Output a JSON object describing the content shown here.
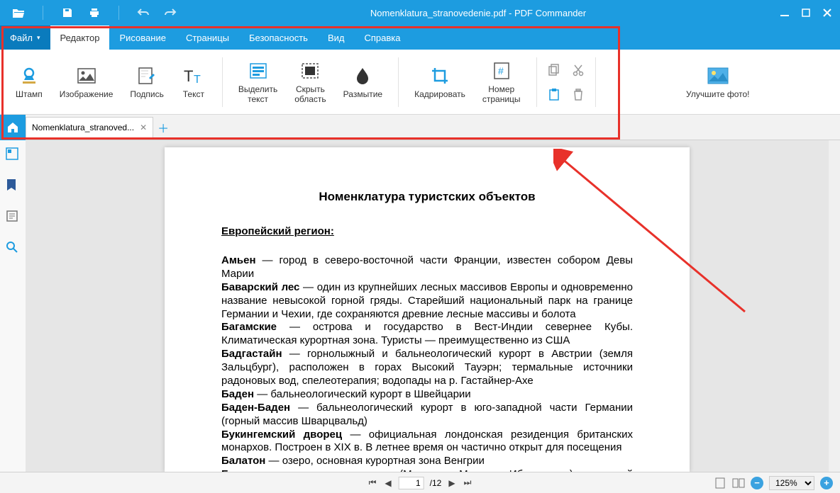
{
  "titlebar": {
    "title": "Nomenklatura_stranovedenie.pdf - PDF Commander"
  },
  "menu": {
    "file": "Файл",
    "editor": "Редактор",
    "draw": "Рисование",
    "pages": "Страницы",
    "security": "Безопасность",
    "view": "Вид",
    "help": "Справка"
  },
  "ribbon": {
    "stamp": "Штамп",
    "image": "Изображение",
    "sign": "Подпись",
    "text": "Текст",
    "hilite": "Выделить\nтекст",
    "hide": "Скрыть\nобласть",
    "blur": "Размытие",
    "crop": "Кадрировать",
    "pagenum": "Номер\nстраницы",
    "enhance": "Улучшите фото!"
  },
  "tabs": {
    "file_short": "Nomenklatura_stranoved..."
  },
  "statusbar": {
    "page_current": "1",
    "page_total": "/12",
    "zoom": "125%"
  },
  "document": {
    "title": "Номенклатура туристских объектов",
    "section": "Европейский регион:",
    "p1": "Амьен — город в северо-восточной части Франции, известен собором Девы Марии",
    "p2": "Баварский лес — один из крупнейших лесных массивов Европы и одновременно название невысокой горной гряды. Старейший национальный парк на границе Германии и Чехии, где сохраняются древние лесные массивы и болота",
    "p3": "Багамские — острова и государство в Вест-Индии севернее Кубы. Климатическая курортная зона. Туристы — преимущественно из США",
    "p4": "Бадгастайн — горнолыжный и бальнеологический курорт в Австрии (земля Зальцбург), расположен в горах Высокий Тауэрн; термальные источники радоновых вод, спелеотерапия; водопады на р. Гастайнер-Ахе",
    "p5": "Баден — бальнеологический курорт в Швейцарии",
    "p6": "Баден-Баден — бальнеологический курорт в юго-западной части Германии (горный массив Шварцвальд)",
    "p7": "Букингемский дворец — официальная лондонская резиденция британских монархов. Построен в XIX в. В летнее время он частично открыт для посещения",
    "p8": "Балатон — озеро, основная курортная зона Венгрии",
    "p9": "Балеарские — испанские острова (Мальорка, Менорка, Ибица и др.) в западной части"
  },
  "doc_terms": {
    "t1": "Амьен",
    "t2": "Баварский лес",
    "t3": "Багамские",
    "t4": "Бадгастайн",
    "t5": "Баден",
    "t6": "Баден-Баден",
    "t7": "Букингемский дворец",
    "t8": "Балатон",
    "t9": "Балеарские"
  }
}
